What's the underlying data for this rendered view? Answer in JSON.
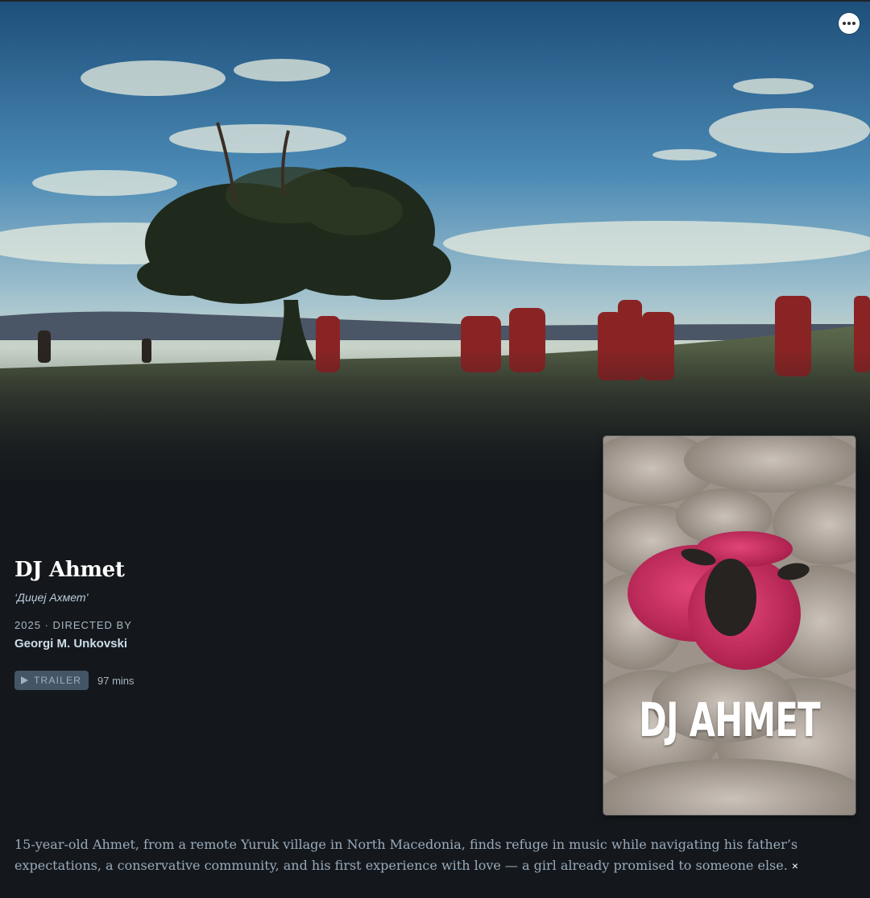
{
  "film": {
    "title": "DJ Ahmet",
    "original_title": "‘Диџеј Ахмет’",
    "release_line": "2025 · DIRECTED BY",
    "director": "Georgi M. Unkovski",
    "trailer_label": "TRAILER",
    "runtime": "97 mins",
    "synopsis": "15-year-old Ahmet, from a remote Yuruk village in North Macedonia, finds refuge in music while navigating his father’s expectations, a conservative community, and his first experience with love — a girl already promised to someone else.",
    "close_label": "×"
  },
  "poster": {
    "title_text": "DJ AHMET"
  },
  "icons": {
    "more": "ellipsis-icon",
    "play": "play-icon",
    "close": "close-icon"
  },
  "colors": {
    "background": "#14181c",
    "trailer_button": "#445566",
    "pink_sheep": "#e0306a",
    "sky": "#3f7fae"
  }
}
